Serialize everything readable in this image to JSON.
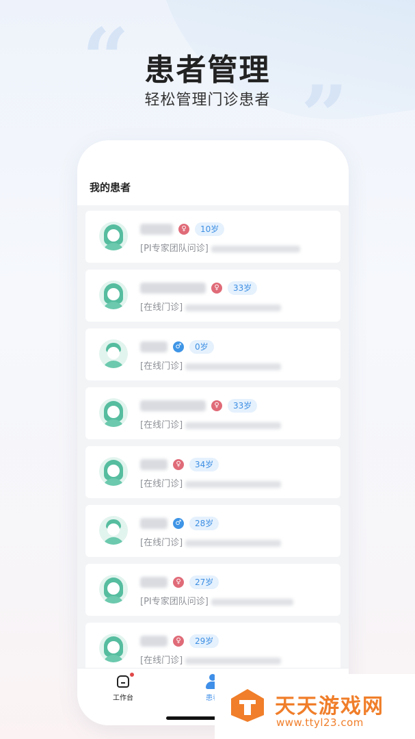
{
  "hero": {
    "title": "患者管理",
    "subtitle": "轻松管理门诊患者"
  },
  "screen": {
    "header_title": "我的患者",
    "patients": [
      {
        "gender": "female",
        "gender_icon": "female-icon",
        "age": "10岁",
        "visit_type": "[PI专家团队问诊]"
      },
      {
        "gender": "female",
        "gender_icon": "female-icon",
        "age": "33岁",
        "visit_type": "[在线门诊]"
      },
      {
        "gender": "male",
        "gender_icon": "male-icon",
        "age": "0岁",
        "visit_type": "[在线门诊]"
      },
      {
        "gender": "female",
        "gender_icon": "female-icon",
        "age": "33岁",
        "visit_type": "[在线门诊]"
      },
      {
        "gender": "female",
        "gender_icon": "female-icon",
        "age": "34岁",
        "visit_type": "[在线门诊]"
      },
      {
        "gender": "male",
        "gender_icon": "male-icon",
        "age": "28岁",
        "visit_type": "[在线门诊]"
      },
      {
        "gender": "female",
        "gender_icon": "female-icon",
        "age": "27岁",
        "visit_type": "[PI专家团队问诊]"
      },
      {
        "gender": "female",
        "gender_icon": "female-icon",
        "age": "29岁",
        "visit_type": "[在线门诊]"
      }
    ],
    "tabbar": {
      "workbench_label": "工作台",
      "patients_label": "患者"
    }
  },
  "watermark": {
    "title": "天天游戏网",
    "url": "www.ttyl23.com"
  },
  "colors": {
    "accent_blue": "#3f8fe8",
    "female": "#e06b78",
    "male": "#3f95e6",
    "avatar_green": "#56bd9f",
    "watermark_orange": "#f07e2a"
  }
}
